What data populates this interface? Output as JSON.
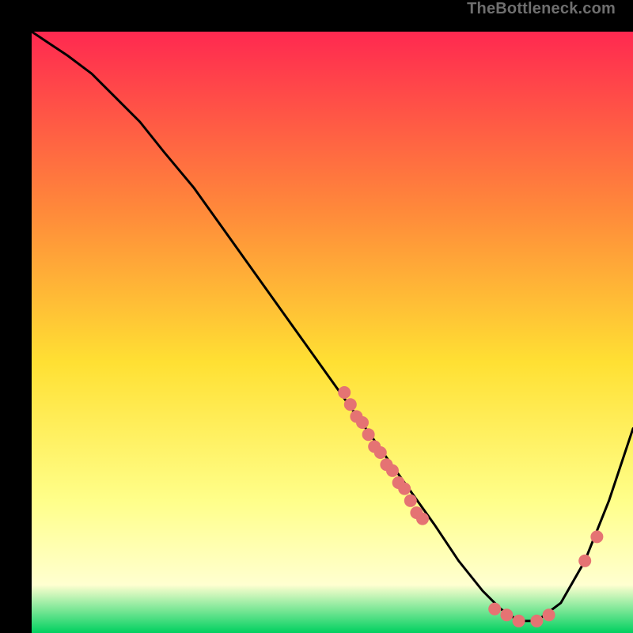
{
  "watermark": "TheBottleneck.com",
  "chart_data": {
    "type": "line",
    "title": "",
    "xlabel": "",
    "ylabel": "",
    "xlim": [
      0,
      100
    ],
    "ylim": [
      0,
      100
    ],
    "grid": false,
    "legend": false,
    "background_gradient": {
      "top": "#ff2950",
      "mid_upper": "#ff8a3a",
      "mid": "#ffe033",
      "mid_lower": "#ffff8a",
      "near_bottom": "#ffffd0",
      "bottom": "#00d060"
    },
    "series": [
      {
        "name": "curve",
        "color": "#000000",
        "stroke_width": 2,
        "x": [
          0,
          3,
          6,
          10,
          14,
          18,
          22,
          27,
          32,
          37,
          42,
          47,
          52,
          57,
          62,
          67,
          71,
          75,
          78,
          81,
          84,
          88,
          92,
          96,
          100
        ],
        "y": [
          100,
          98,
          96,
          93,
          89,
          85,
          80,
          74,
          67,
          60,
          53,
          46,
          39,
          32,
          25,
          18,
          12,
          7,
          4,
          2,
          2,
          5,
          12,
          22,
          34
        ]
      }
    ],
    "points": [
      {
        "name": "cluster-upper",
        "color": "#e57373",
        "r": 8,
        "data": [
          {
            "x": 52,
            "y": 40
          },
          {
            "x": 53,
            "y": 38
          },
          {
            "x": 54,
            "y": 36
          },
          {
            "x": 55,
            "y": 35
          },
          {
            "x": 56,
            "y": 33
          },
          {
            "x": 57,
            "y": 31
          },
          {
            "x": 58,
            "y": 30
          },
          {
            "x": 59,
            "y": 28
          },
          {
            "x": 60,
            "y": 27
          },
          {
            "x": 61,
            "y": 25
          },
          {
            "x": 62,
            "y": 24
          },
          {
            "x": 63,
            "y": 22
          },
          {
            "x": 64,
            "y": 20
          },
          {
            "x": 65,
            "y": 19
          }
        ]
      },
      {
        "name": "cluster-valley",
        "color": "#e57373",
        "r": 8,
        "data": [
          {
            "x": 77,
            "y": 4
          },
          {
            "x": 79,
            "y": 3
          },
          {
            "x": 81,
            "y": 2
          },
          {
            "x": 84,
            "y": 2
          },
          {
            "x": 86,
            "y": 3
          }
        ]
      },
      {
        "name": "cluster-right",
        "color": "#e57373",
        "r": 8,
        "data": [
          {
            "x": 92,
            "y": 12
          },
          {
            "x": 94,
            "y": 16
          }
        ]
      }
    ]
  }
}
